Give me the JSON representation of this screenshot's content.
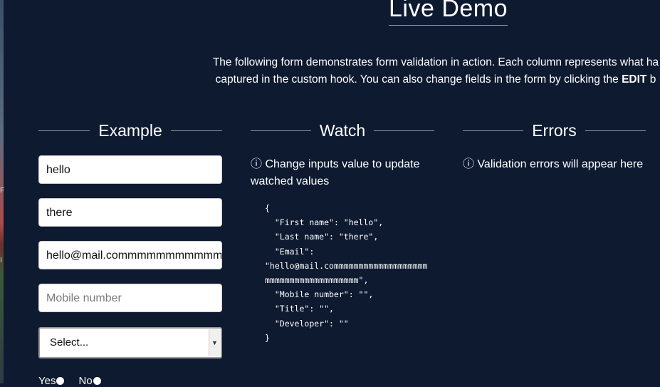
{
  "page": {
    "title": "Live Demo",
    "intro_line1": "The following form demonstrates form validation in action. Each column represents what ha",
    "intro_line2_pre": "captured in the custom hook. You can also change fields in the form by clicking the ",
    "intro_line2_bold": "EDIT",
    "intro_line2_post": " b"
  },
  "left_edge_marks": [
    "F",
    "I"
  ],
  "columns": {
    "example": "Example",
    "watch": "Watch",
    "errors": "Errors"
  },
  "form": {
    "first_name_value": "hello",
    "last_name_value": "there",
    "email_value": "hello@mail.commmmmmmmmmmmm",
    "mobile_placeholder": "Mobile number",
    "title_select_value": "Select...",
    "radio_yes": "Yes",
    "radio_no": "No"
  },
  "watch": {
    "hint": "ⓘ Change inputs value to update watched values",
    "json": "{\n  \"First name\": \"hello\",\n  \"Last name\": \"there\",\n  \"Email\":\n\"hello@mail.commmmmmmmmmmmmmmmmmmmmmmmmmmmmmmmmmmmmm\",\n  \"Mobile number\": \"\",\n  \"Title\": \"\",\n  \"Developer\": \"\"\n}"
  },
  "errors": {
    "hint": "ⓘ Validation errors will appear here"
  },
  "colors": {
    "background": "#0d1a30",
    "text": "#ffffff"
  }
}
